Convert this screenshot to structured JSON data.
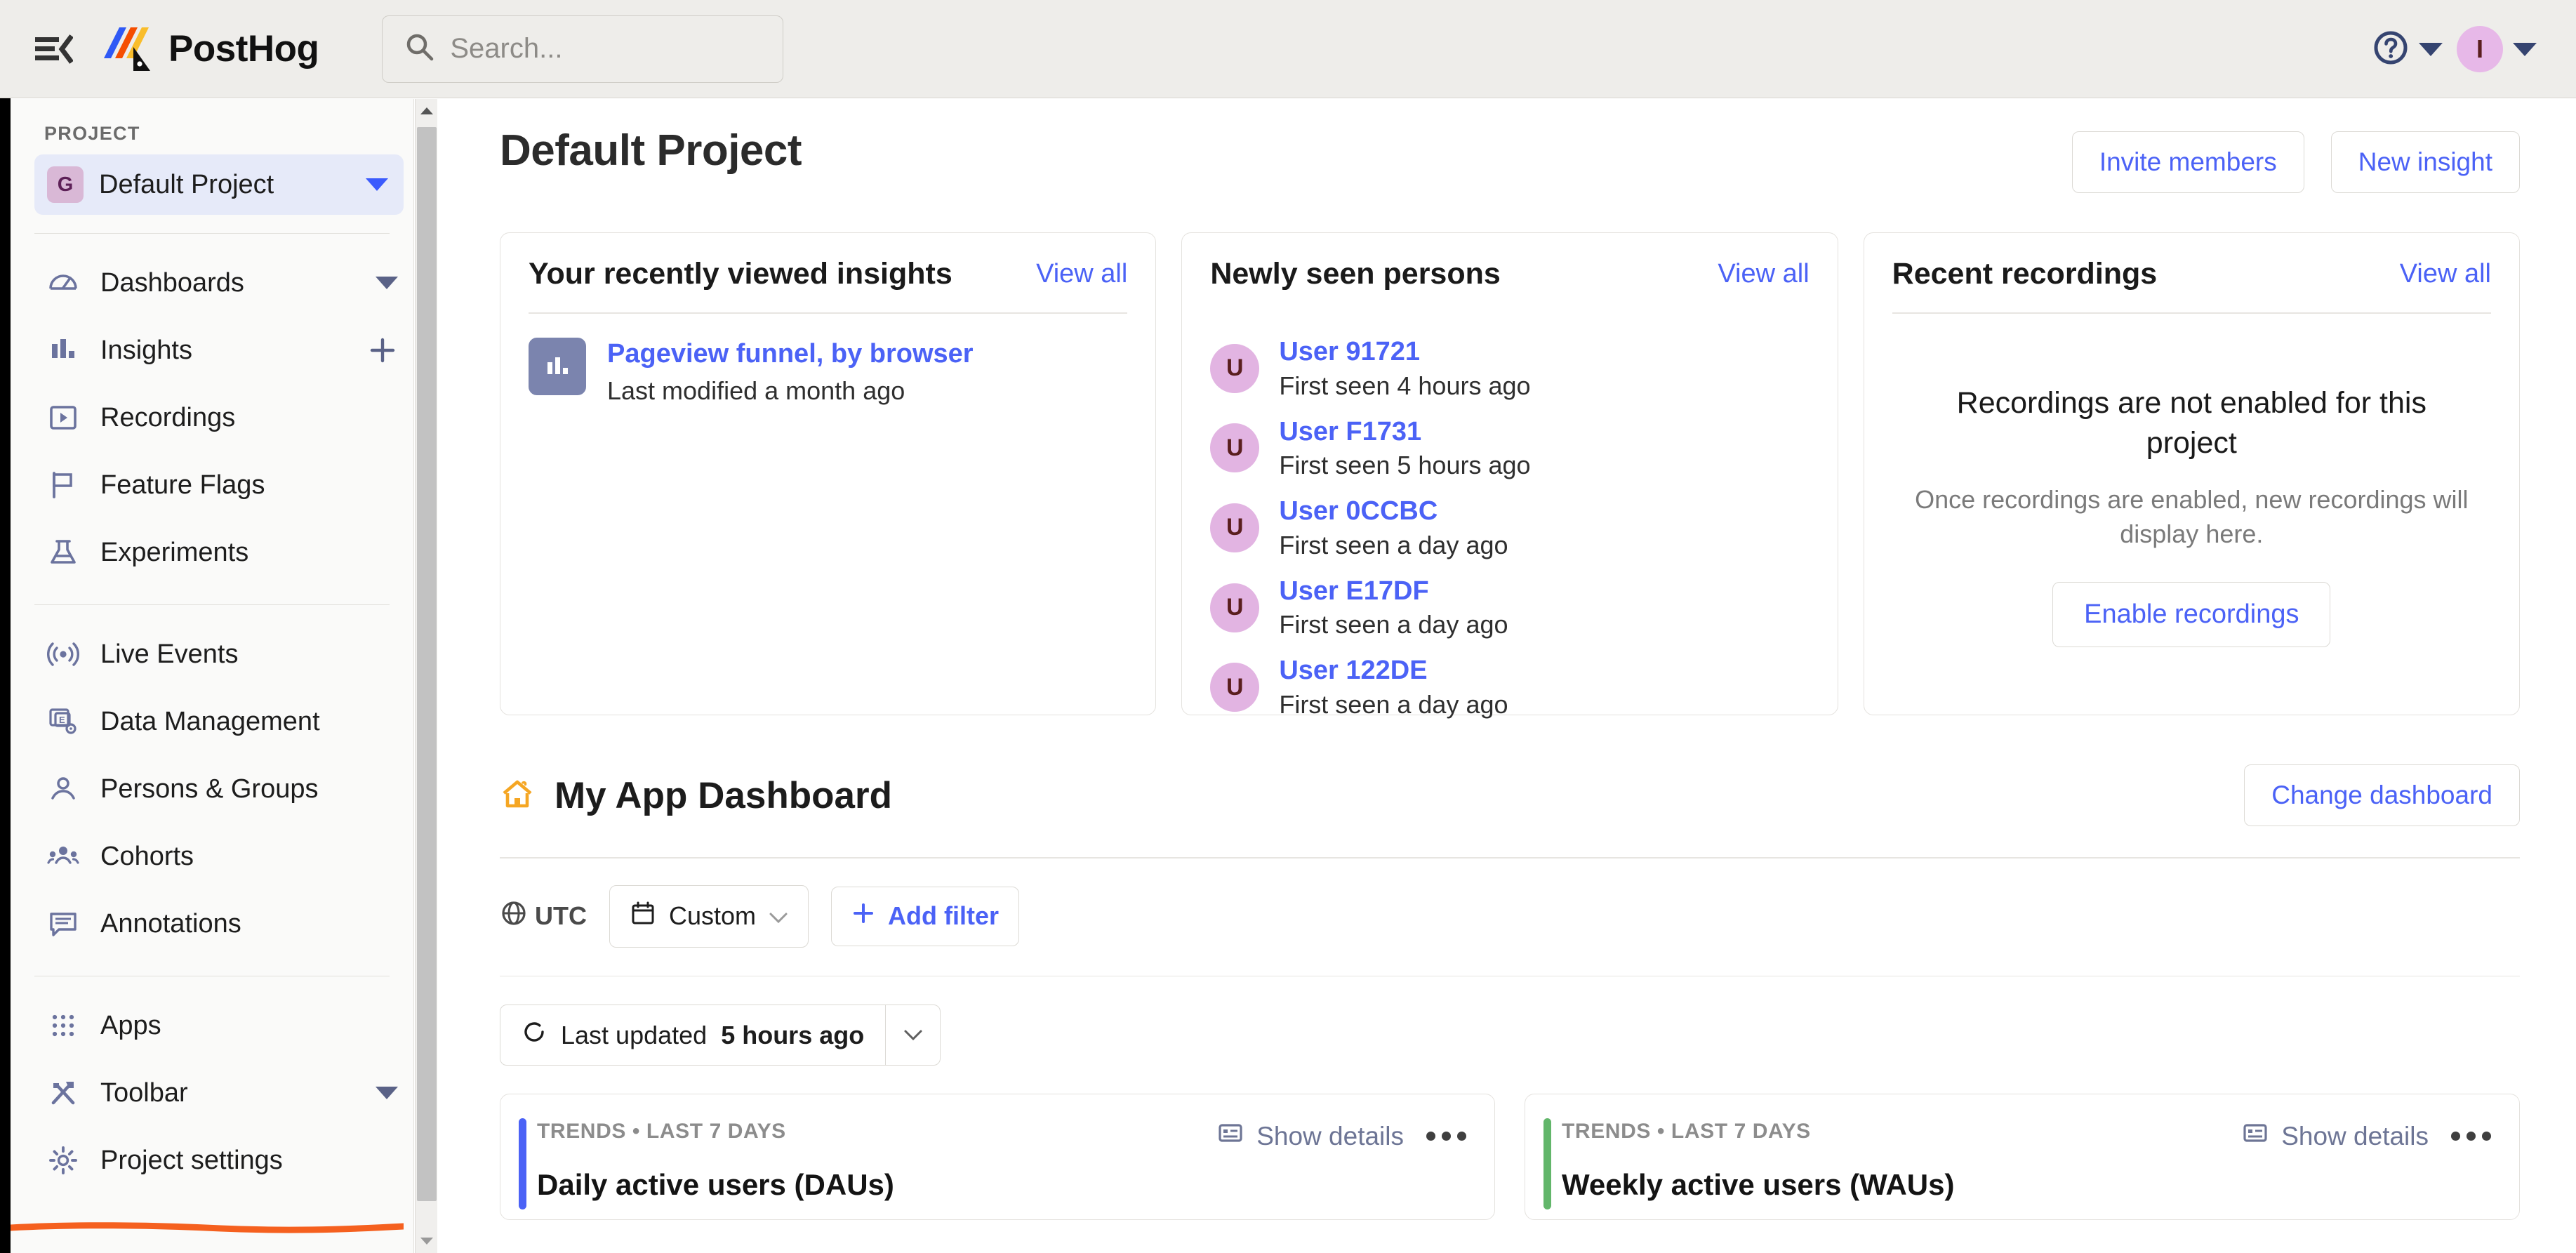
{
  "topbar": {
    "menu_icon": "menu-collapse-icon",
    "brand": "PostHog",
    "search_placeholder": "Search...",
    "help_icon": "question-circle-icon",
    "avatar_initial": "I"
  },
  "sidebar": {
    "section_label": "PROJECT",
    "project": {
      "badge": "G",
      "name": "Default Project"
    },
    "group_one": [
      {
        "label": "Dashboards",
        "icon": "gauge-icon",
        "trailing": "caret"
      },
      {
        "label": "Insights",
        "icon": "bar-chart-icon",
        "trailing": "plus"
      },
      {
        "label": "Recordings",
        "icon": "play-square-icon",
        "trailing": ""
      },
      {
        "label": "Feature Flags",
        "icon": "flag-icon",
        "trailing": ""
      },
      {
        "label": "Experiments",
        "icon": "flask-icon",
        "trailing": ""
      }
    ],
    "group_two": [
      {
        "label": "Live Events",
        "icon": "broadcast-icon",
        "trailing": ""
      },
      {
        "label": "Data Management",
        "icon": "data-stack-gear-icon",
        "trailing": ""
      },
      {
        "label": "Persons & Groups",
        "icon": "person-icon",
        "trailing": ""
      },
      {
        "label": "Cohorts",
        "icon": "people-group-icon",
        "trailing": ""
      },
      {
        "label": "Annotations",
        "icon": "comment-lines-icon",
        "trailing": ""
      }
    ],
    "group_three": [
      {
        "label": "Apps",
        "icon": "grid-dots-icon",
        "trailing": ""
      },
      {
        "label": "Toolbar",
        "icon": "hammer-screwdriver-icon",
        "trailing": "caret"
      },
      {
        "label": "Project settings",
        "icon": "gear-icon",
        "trailing": ""
      }
    ],
    "annotation": {
      "type": "orange-underline",
      "under_item": "Toolbar",
      "color": "#f5601f"
    }
  },
  "main": {
    "page_title": "Default Project",
    "header_buttons": {
      "invite_members": "Invite members",
      "new_insight": "New insight"
    },
    "cards": {
      "recent_insights": {
        "title": "Your recently viewed insights",
        "view_all": "View all",
        "items": [
          {
            "name": "Pageview funnel, by browser",
            "sub": "Last modified a month ago",
            "icon": "bar-chart-icon"
          }
        ]
      },
      "newly_seen_persons": {
        "title": "Newly seen persons",
        "view_all": "View all",
        "items": [
          {
            "avatar": "U",
            "name": "User 91721",
            "sub": "First seen 4 hours ago"
          },
          {
            "avatar": "U",
            "name": "User F1731",
            "sub": "First seen 5 hours ago"
          },
          {
            "avatar": "U",
            "name": "User 0CCBC",
            "sub": "First seen a day ago"
          },
          {
            "avatar": "U",
            "name": "User E17DF",
            "sub": "First seen a day ago"
          },
          {
            "avatar": "U",
            "name": "User 122DE",
            "sub": "First seen a day ago"
          }
        ]
      },
      "recent_recordings": {
        "title": "Recent recordings",
        "view_all": "View all",
        "empty_title": "Recordings are not enabled for this project",
        "empty_sub": "Once recordings are enabled, new recordings will display here.",
        "enable_button": "Enable recordings"
      }
    },
    "dashboard": {
      "icon": "home-icon",
      "title": "My App Dashboard",
      "change_button": "Change dashboard",
      "timezone": "UTC",
      "date_range": "Custom",
      "add_filter": "Add filter",
      "refresh_prefix": "Last updated",
      "refresh_value": "5 hours ago"
    },
    "insight_tiles": [
      {
        "meta": "TRENDS • LAST 7 DAYS",
        "name": "Daily active users (DAUs)",
        "show_details": "Show details",
        "accent": "#4b62f6"
      },
      {
        "meta": "TRENDS • LAST 7 DAYS",
        "name": "Weekly active users (WAUs)",
        "show_details": "Show details",
        "accent": "#62b66a"
      }
    ]
  }
}
